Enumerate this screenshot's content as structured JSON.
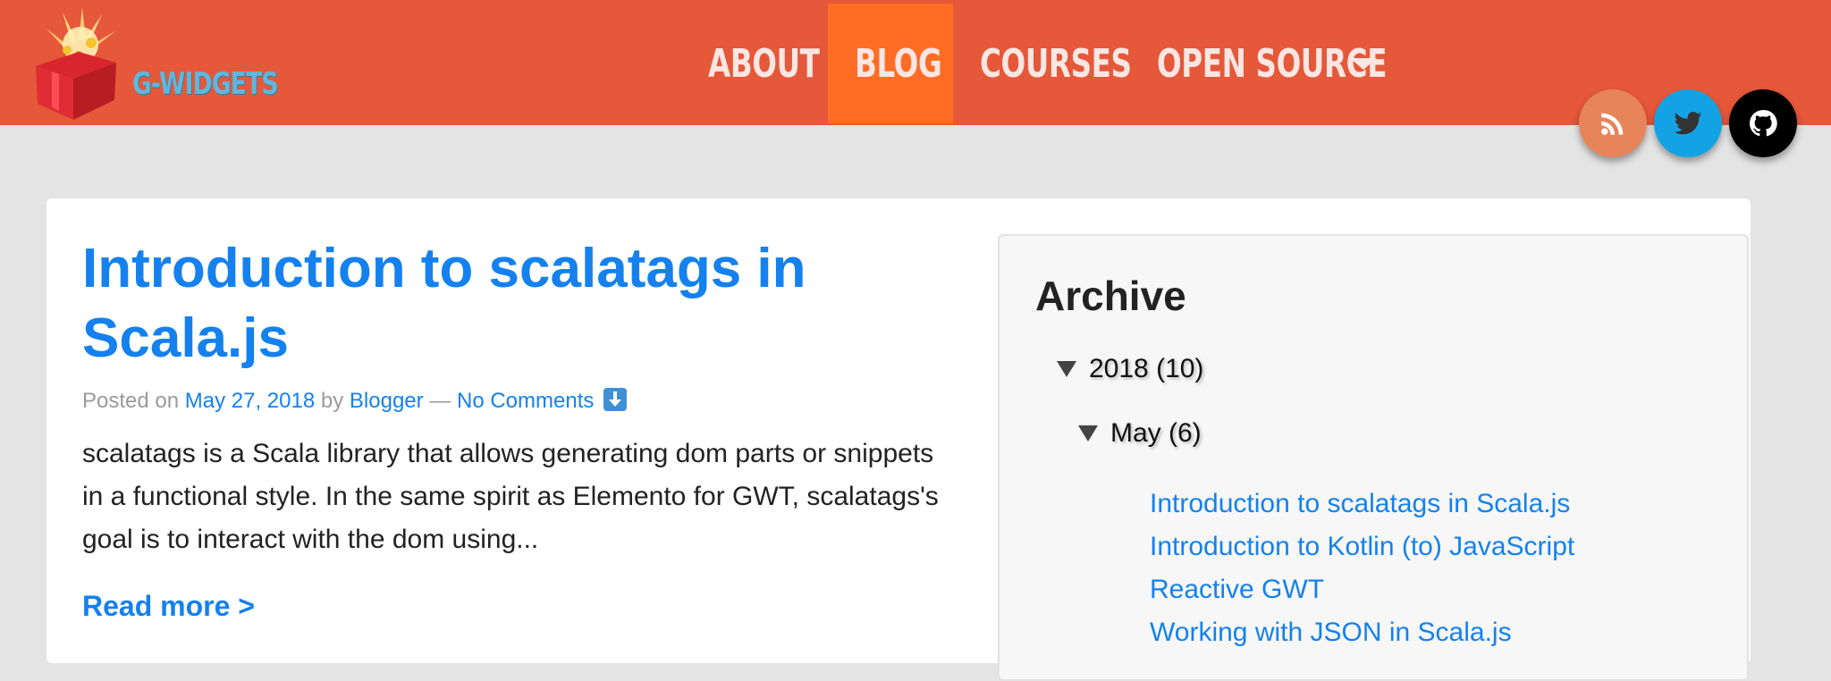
{
  "brand": {
    "name": "G-WIDGETS",
    "colors": {
      "header": "#e55839",
      "active_nav": "#ff6d24",
      "link": "#1481ee",
      "logo_text": "#5fb7dd"
    }
  },
  "nav": {
    "items": [
      {
        "label": "ABOUT",
        "active": false
      },
      {
        "label": "BLOG",
        "active": true
      },
      {
        "label": "COURSES",
        "active": false
      },
      {
        "label": "OPEN SOURCE",
        "active": false,
        "dropdown": true
      }
    ]
  },
  "social": [
    {
      "icon": "rss-icon",
      "color": "#e8845a"
    },
    {
      "icon": "twitter-icon",
      "color": "#13a3e5"
    },
    {
      "icon": "github-icon",
      "color": "#000000"
    }
  ],
  "post": {
    "title": "Introduction to scalatags in Scala.js",
    "meta": {
      "posted_on": "Posted on",
      "date": "May 27, 2018",
      "by": "by",
      "author": "Blogger",
      "dash": "—",
      "comments": "No Comments",
      "comments_icon": "download-arrow-icon"
    },
    "excerpt": "scalatags is a Scala library that allows generating dom parts or snippets in a functional style. In the same spirit as Elemento for GWT, scalatags's goal is to interact with the dom using...",
    "read_more": "Read more >"
  },
  "archive": {
    "title": "Archive",
    "year": {
      "label": "2018 (10)",
      "expanded": true
    },
    "month": {
      "label": "May (6)",
      "expanded": true
    },
    "posts": [
      "Introduction to scalatags in Scala.js",
      "Introduction to Kotlin (to) JavaScript",
      "Reactive GWT",
      "Working with JSON in Scala.js"
    ]
  }
}
